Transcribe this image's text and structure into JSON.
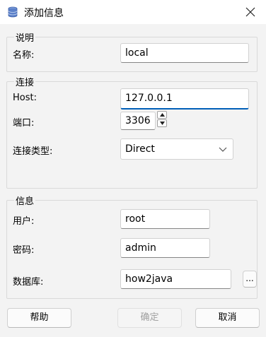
{
  "window": {
    "title": "添加信息"
  },
  "groups": {
    "desc": {
      "title": "说明",
      "name_label": "名称:",
      "name_value": "local"
    },
    "connect": {
      "title": "连接",
      "host_label": "Host:",
      "host_value": "127.0.0.1",
      "port_label": "端口:",
      "port_value": "3306",
      "type_label": "连接类型:",
      "type_value": "Direct"
    },
    "info": {
      "title": "信息",
      "user_label": "用户:",
      "user_value": "root",
      "password_label": "密码:",
      "password_value": "admin",
      "db_label": "数据库:",
      "db_value": "how2java",
      "browse_label": "..."
    }
  },
  "buttons": {
    "help": "帮助",
    "ok": "确定",
    "cancel": "取消"
  },
  "colors": {
    "accent": "#005fb8",
    "background": "#f3f3f3"
  }
}
